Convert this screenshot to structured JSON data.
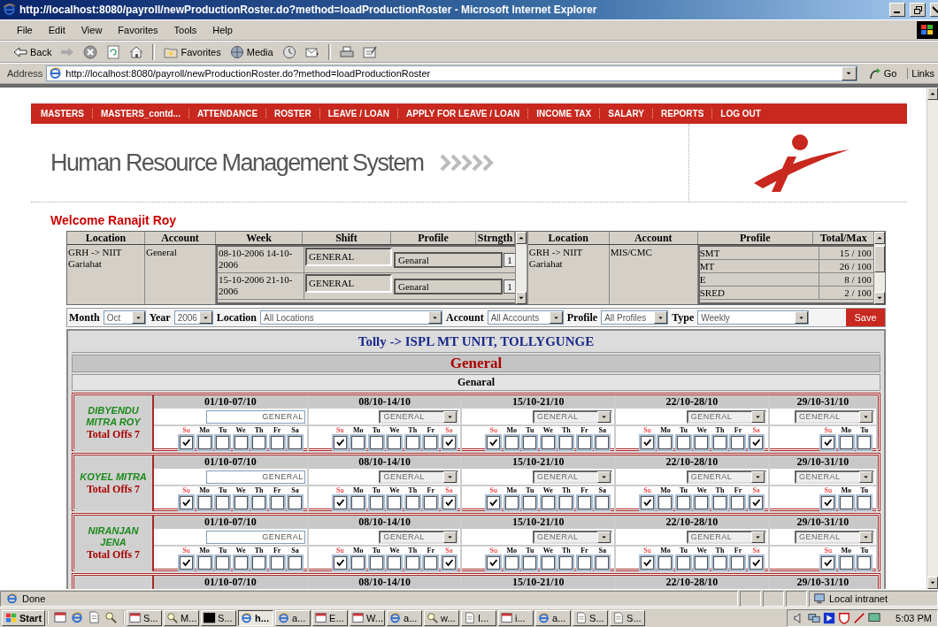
{
  "window": {
    "title": "http://localhost:8080/payroll/newProductionRoster.do?method=loadProductionRoster - Microsoft Internet Explorer"
  },
  "menu": [
    "File",
    "Edit",
    "View",
    "Favorites",
    "Tools",
    "Help"
  ],
  "toolbar": [
    {
      "kind": "back",
      "label": "Back"
    },
    {
      "kind": "forward"
    },
    {
      "kind": "stop"
    },
    {
      "kind": "refresh"
    },
    {
      "kind": "home"
    },
    {
      "kind": "favorites",
      "label": "Favorites"
    },
    {
      "kind": "media",
      "label": "Media"
    },
    {
      "kind": "history"
    },
    {
      "kind": "mail"
    },
    {
      "kind": "print"
    },
    {
      "kind": "edit"
    }
  ],
  "address": {
    "label": "Address",
    "url": "http://localhost:8080/payroll/newProductionRoster.do?method=loadProductionRoster",
    "go": "Go",
    "links": "Links"
  },
  "nav": [
    "MASTERS",
    "MASTERS_contd...",
    "ATTENDANCE",
    "ROSTER",
    "LEAVE / LOAN",
    "APPLY FOR LEAVE / LOAN",
    "INCOME TAX",
    "SALARY",
    "REPORTS",
    "LOG OUT"
  ],
  "header": {
    "title": "Human Resource Management System"
  },
  "welcome": "Welcome Ranajit Roy",
  "assignments": {
    "columns": [
      "Location",
      "Account",
      "Week",
      "Shift",
      "Profile",
      "Strngth"
    ],
    "rows": [
      {
        "location": "GRH -> NIIT Gariahat",
        "account": "General",
        "entries": [
          {
            "week": "08-10-2006 14-10-2006",
            "shift": "GENERAL",
            "profile": "Genaral",
            "strength": "1"
          },
          {
            "week": "15-10-2006 21-10-2006",
            "shift": "GENERAL",
            "profile": "Genaral",
            "strength": "1"
          }
        ]
      }
    ]
  },
  "capacity": {
    "columns": [
      "Location",
      "Account",
      "Profile",
      "Total/Max"
    ],
    "rows": [
      {
        "location": "GRH -> NIIT Gariahat",
        "account": "MIS/CMC",
        "profiles": [
          {
            "profile": "SMT",
            "total": "15 / 100"
          },
          {
            "profile": "MT",
            "total": "26 / 100"
          },
          {
            "profile": "E",
            "total": "8 / 100"
          },
          {
            "profile": "SRED",
            "total": "2 / 100"
          }
        ]
      }
    ]
  },
  "filters": [
    {
      "label": "Month",
      "value": "Oct"
    },
    {
      "label": "Year",
      "value": "2006"
    },
    {
      "label": "Location",
      "value": "All Locations"
    },
    {
      "label": "Account",
      "value": "All Accounts"
    },
    {
      "label": "Profile",
      "value": "All Profiles"
    },
    {
      "label": "Type",
      "value": "Weekly"
    }
  ],
  "save": "Save",
  "roster": {
    "location": "Tolly -> ISPL MT UNIT, TOLLYGUNGE",
    "account": "General",
    "profile": "Genaral",
    "employees": [
      {
        "name": "DIBYENDU MITRA ROY",
        "total_offs": "Total Offs 7",
        "weeks": [
          {
            "range": "01/10-07/10",
            "shift": {
              "kind": "text",
              "value": "GENERAL"
            },
            "days": [
              {
                "label": "Su",
                "checked": true
              },
              {
                "label": "Mo",
                "checked": false
              },
              {
                "label": "Tu",
                "checked": false
              },
              {
                "label": "We",
                "checked": false
              },
              {
                "label": "Th",
                "checked": false
              },
              {
                "label": "Fr",
                "checked": false
              },
              {
                "label": "Sa",
                "checked": false
              }
            ]
          },
          {
            "range": "08/10-14/10",
            "shift": {
              "kind": "select",
              "value": "GENERAL"
            },
            "days": [
              {
                "label": "Su",
                "checked": true
              },
              {
                "label": "Mo",
                "checked": false
              },
              {
                "label": "Tu",
                "checked": false
              },
              {
                "label": "We",
                "checked": false
              },
              {
                "label": "Th",
                "checked": false
              },
              {
                "label": "Fr",
                "checked": false
              },
              {
                "label": "Sa",
                "checked": true
              }
            ]
          },
          {
            "range": "15/10-21/10",
            "shift": {
              "kind": "select",
              "value": "GENERAL"
            },
            "days": [
              {
                "label": "Su",
                "checked": true
              },
              {
                "label": "Mo",
                "checked": false
              },
              {
                "label": "Tu",
                "checked": false
              },
              {
                "label": "We",
                "checked": false
              },
              {
                "label": "Th",
                "checked": false
              },
              {
                "label": "Fr",
                "checked": false
              },
              {
                "label": "Sa",
                "checked": false
              }
            ]
          },
          {
            "range": "22/10-28/10",
            "shift": {
              "kind": "select",
              "value": "GENERAL"
            },
            "days": [
              {
                "label": "Su",
                "checked": true
              },
              {
                "label": "Mo",
                "checked": false
              },
              {
                "label": "Tu",
                "checked": false
              },
              {
                "label": "We",
                "checked": false
              },
              {
                "label": "Th",
                "checked": false
              },
              {
                "label": "Fr",
                "checked": false
              },
              {
                "label": "Sa",
                "checked": true
              }
            ]
          },
          {
            "range": "29/10-31/10",
            "shift": {
              "kind": "select",
              "value": "GENERAL"
            },
            "days": [
              {
                "label": "Su",
                "checked": true
              },
              {
                "label": "Mo",
                "checked": false
              },
              {
                "label": "Tu",
                "checked": false
              }
            ]
          }
        ]
      },
      {
        "name": "KOYEL MITRA",
        "total_offs": "Total Offs 7",
        "weeks": [
          {
            "range": "01/10-07/10",
            "shift": {
              "kind": "text",
              "value": "GENERAL"
            },
            "days": [
              {
                "label": "Su",
                "checked": true
              },
              {
                "label": "Mo",
                "checked": false
              },
              {
                "label": "Tu",
                "checked": false
              },
              {
                "label": "We",
                "checked": false
              },
              {
                "label": "Th",
                "checked": false
              },
              {
                "label": "Fr",
                "checked": false
              },
              {
                "label": "Sa",
                "checked": false
              }
            ]
          },
          {
            "range": "08/10-14/10",
            "shift": {
              "kind": "select",
              "value": "GENERAL"
            },
            "days": [
              {
                "label": "Su",
                "checked": true
              },
              {
                "label": "Mo",
                "checked": false
              },
              {
                "label": "Tu",
                "checked": false
              },
              {
                "label": "We",
                "checked": false
              },
              {
                "label": "Th",
                "checked": false
              },
              {
                "label": "Fr",
                "checked": false
              },
              {
                "label": "Sa",
                "checked": true
              }
            ]
          },
          {
            "range": "15/10-21/10",
            "shift": {
              "kind": "select",
              "value": "GENERAL"
            },
            "days": [
              {
                "label": "Su",
                "checked": true
              },
              {
                "label": "Mo",
                "checked": false
              },
              {
                "label": "Tu",
                "checked": false
              },
              {
                "label": "We",
                "checked": false
              },
              {
                "label": "Th",
                "checked": false
              },
              {
                "label": "Fr",
                "checked": false
              },
              {
                "label": "Sa",
                "checked": false
              }
            ]
          },
          {
            "range": "22/10-28/10",
            "shift": {
              "kind": "select",
              "value": "GENERAL"
            },
            "days": [
              {
                "label": "Su",
                "checked": true
              },
              {
                "label": "Mo",
                "checked": false
              },
              {
                "label": "Tu",
                "checked": false
              },
              {
                "label": "We",
                "checked": false
              },
              {
                "label": "Th",
                "checked": false
              },
              {
                "label": "Fr",
                "checked": false
              },
              {
                "label": "Sa",
                "checked": true
              }
            ]
          },
          {
            "range": "29/10-31/10",
            "shift": {
              "kind": "select",
              "value": "GENERAL"
            },
            "days": [
              {
                "label": "Su",
                "checked": true
              },
              {
                "label": "Mo",
                "checked": false
              },
              {
                "label": "Tu",
                "checked": false
              }
            ]
          }
        ]
      },
      {
        "name": "NIRANJAN JENA",
        "total_offs": "Total Offs 7",
        "weeks": [
          {
            "range": "01/10-07/10",
            "shift": {
              "kind": "text",
              "value": "GENERAL"
            },
            "days": [
              {
                "label": "Su",
                "checked": true
              },
              {
                "label": "Mo",
                "checked": false
              },
              {
                "label": "Tu",
                "checked": false
              },
              {
                "label": "We",
                "checked": false
              },
              {
                "label": "Th",
                "checked": false
              },
              {
                "label": "Fr",
                "checked": false
              },
              {
                "label": "Sa",
                "checked": false
              }
            ]
          },
          {
            "range": "08/10-14/10",
            "shift": {
              "kind": "select",
              "value": "GENERAL"
            },
            "days": [
              {
                "label": "Su",
                "checked": true
              },
              {
                "label": "Mo",
                "checked": false
              },
              {
                "label": "Tu",
                "checked": false
              },
              {
                "label": "We",
                "checked": false
              },
              {
                "label": "Th",
                "checked": false
              },
              {
                "label": "Fr",
                "checked": false
              },
              {
                "label": "Sa",
                "checked": true
              }
            ]
          },
          {
            "range": "15/10-21/10",
            "shift": {
              "kind": "select",
              "value": "GENERAL"
            },
            "days": [
              {
                "label": "Su",
                "checked": true
              },
              {
                "label": "Mo",
                "checked": false
              },
              {
                "label": "Tu",
                "checked": false
              },
              {
                "label": "We",
                "checked": false
              },
              {
                "label": "Th",
                "checked": false
              },
              {
                "label": "Fr",
                "checked": false
              },
              {
                "label": "Sa",
                "checked": false
              }
            ]
          },
          {
            "range": "22/10-28/10",
            "shift": {
              "kind": "select",
              "value": "GENERAL"
            },
            "days": [
              {
                "label": "Su",
                "checked": true
              },
              {
                "label": "Mo",
                "checked": false
              },
              {
                "label": "Tu",
                "checked": false
              },
              {
                "label": "We",
                "checked": false
              },
              {
                "label": "Th",
                "checked": false
              },
              {
                "label": "Fr",
                "checked": false
              },
              {
                "label": "Sa",
                "checked": true
              }
            ]
          },
          {
            "range": "29/10-31/10",
            "shift": {
              "kind": "select",
              "value": "GENERAL"
            },
            "days": [
              {
                "label": "Su",
                "checked": true
              },
              {
                "label": "Mo",
                "checked": false
              },
              {
                "label": "Tu",
                "checked": false
              }
            ]
          }
        ]
      },
      {
        "weeks": [
          {
            "range": "01/10-07/10"
          },
          {
            "range": "08/10-14/10"
          },
          {
            "range": "15/10-21/10"
          },
          {
            "range": "22/10-28/10"
          },
          {
            "range": "29/10-31/10"
          }
        ]
      }
    ]
  },
  "status_bar": {
    "text": "Done",
    "zone": "Local intranet"
  },
  "taskbar": {
    "start": "Start",
    "tasks": [
      {
        "kind": "app",
        "label": "S...",
        "selected": false
      },
      {
        "kind": "search",
        "label": "M...",
        "selected": false
      },
      {
        "kind": "console",
        "label": "S...",
        "selected": false
      },
      {
        "kind": "browser",
        "label": "h...",
        "selected": true
      },
      {
        "kind": "browser",
        "label": "a...",
        "selected": false
      },
      {
        "kind": "app",
        "label": "E...",
        "selected": false
      },
      {
        "kind": "app",
        "label": "W...",
        "selected": false
      },
      {
        "kind": "browser",
        "label": "a...",
        "selected": false
      },
      {
        "kind": "search",
        "label": "w...",
        "selected": false
      },
      {
        "kind": "doc",
        "label": "I...",
        "selected": false
      },
      {
        "kind": "app",
        "label": "i...",
        "selected": false
      },
      {
        "kind": "browser",
        "label": "a...",
        "selected": false
      },
      {
        "kind": "doc",
        "label": "S...",
        "selected": false
      },
      {
        "kind": "doc",
        "label": "S...",
        "selected": false
      }
    ],
    "clock": "5:03 PM"
  }
}
